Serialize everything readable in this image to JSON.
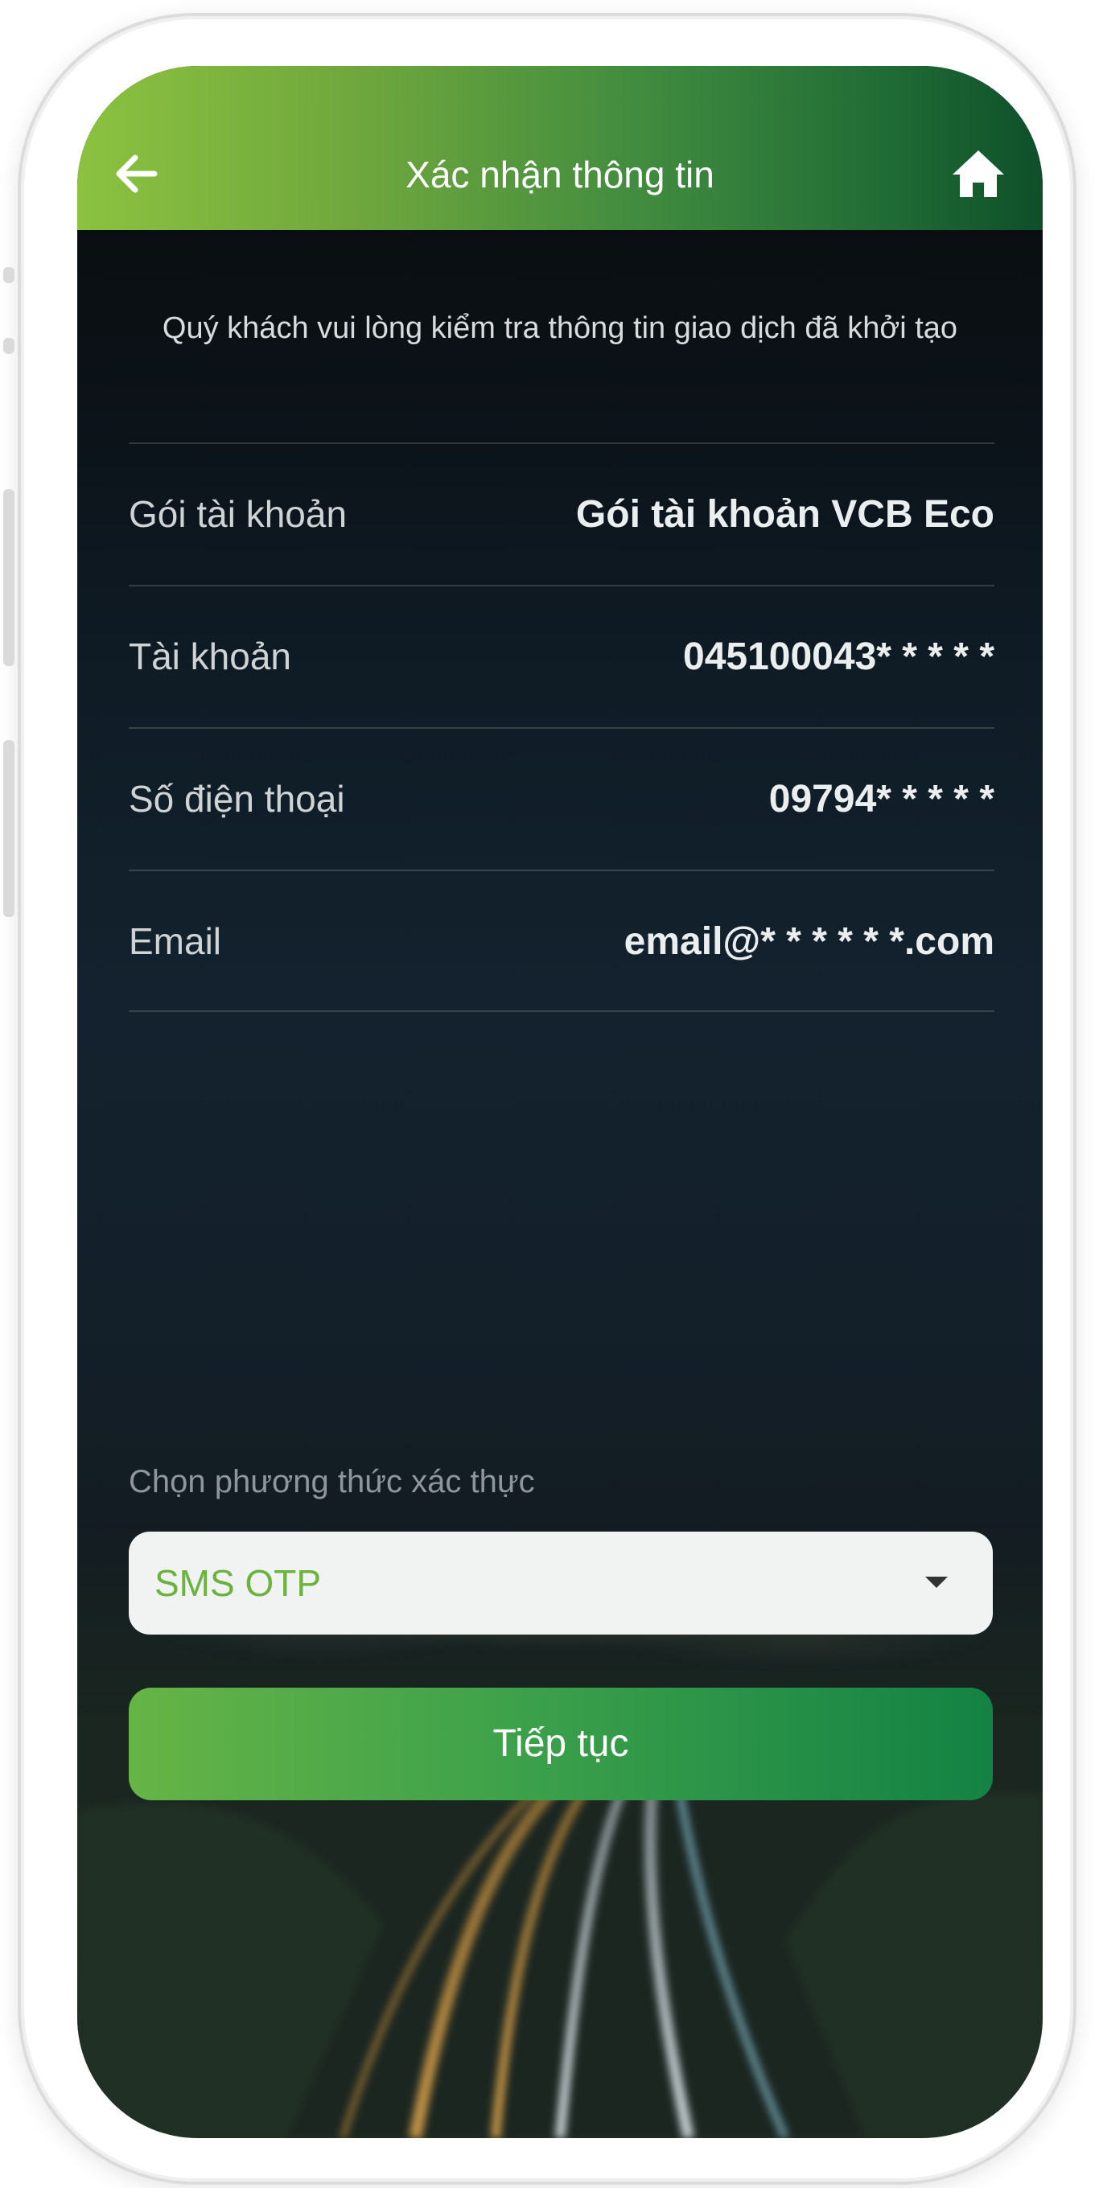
{
  "header": {
    "title": "Xác nhận thông tin",
    "back_icon": "arrow-left-icon",
    "home_icon": "home-icon"
  },
  "instruction": "Quý khách vui lòng kiểm tra thông tin giao dịch đã khởi tạo",
  "info_rows": [
    {
      "label": "Gói tài khoản",
      "value": "Gói tài khoản VCB Eco"
    },
    {
      "label": "Tài khoản",
      "value": "045100043* * * * *"
    },
    {
      "label": "Số điện thoại",
      "value": "09794* * * * *"
    },
    {
      "label": "Email",
      "value": "email@* * * * * *.com"
    }
  ],
  "auth": {
    "label": "Chọn phương thức xác thực",
    "selected": "SMS OTP"
  },
  "continue_label": "Tiếp tục",
  "colors": {
    "header_start": "#8cc23f",
    "header_end": "#0f4f2a",
    "accent_green": "#6cb33e",
    "button_start": "#66b446",
    "button_end": "#138244"
  }
}
